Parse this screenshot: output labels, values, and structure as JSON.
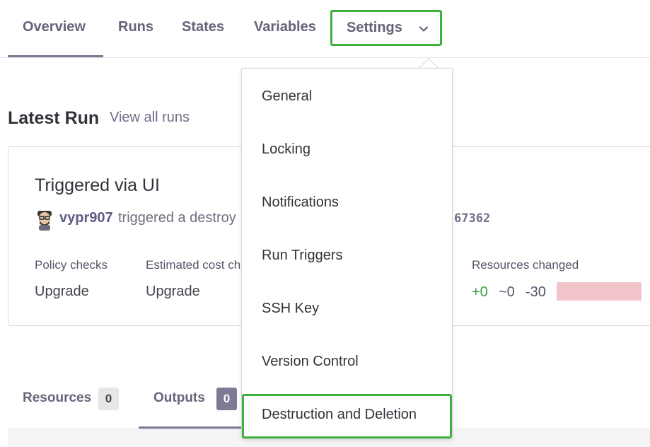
{
  "nav": {
    "tabs": [
      {
        "label": "Overview"
      },
      {
        "label": "Runs"
      },
      {
        "label": "States"
      },
      {
        "label": "Variables"
      }
    ],
    "settings_label": "Settings",
    "settings_icon": "chevron-down-icon"
  },
  "latest_run": {
    "title": "Latest Run",
    "view_all": "View all runs",
    "card": {
      "title": "Triggered via UI",
      "user": "vypr907",
      "description": "triggered a destroy",
      "run_id": "67362",
      "stats": [
        {
          "label": "Policy checks",
          "value": "Upgrade"
        },
        {
          "label": "Estimated cost ch",
          "value": "Upgrade"
        }
      ],
      "resources": {
        "label": "Resources changed",
        "added": "+0",
        "changed": "~0",
        "destroyed": "-30"
      }
    }
  },
  "bottom_tabs": [
    {
      "label": "Resources",
      "count": "0"
    },
    {
      "label": "Outputs",
      "count": "0"
    }
  ],
  "settings_menu": {
    "items": [
      {
        "label": "General"
      },
      {
        "label": "Locking"
      },
      {
        "label": "Notifications"
      },
      {
        "label": "Run Triggers"
      },
      {
        "label": "SSH Key"
      },
      {
        "label": "Version Control"
      },
      {
        "label": "Destruction and Deletion"
      }
    ]
  },
  "colors": {
    "highlight": "#3db13d",
    "accent": "#7d7a95",
    "added": "#3a9a3a",
    "destroyed_bar": "#f1c4c9"
  }
}
